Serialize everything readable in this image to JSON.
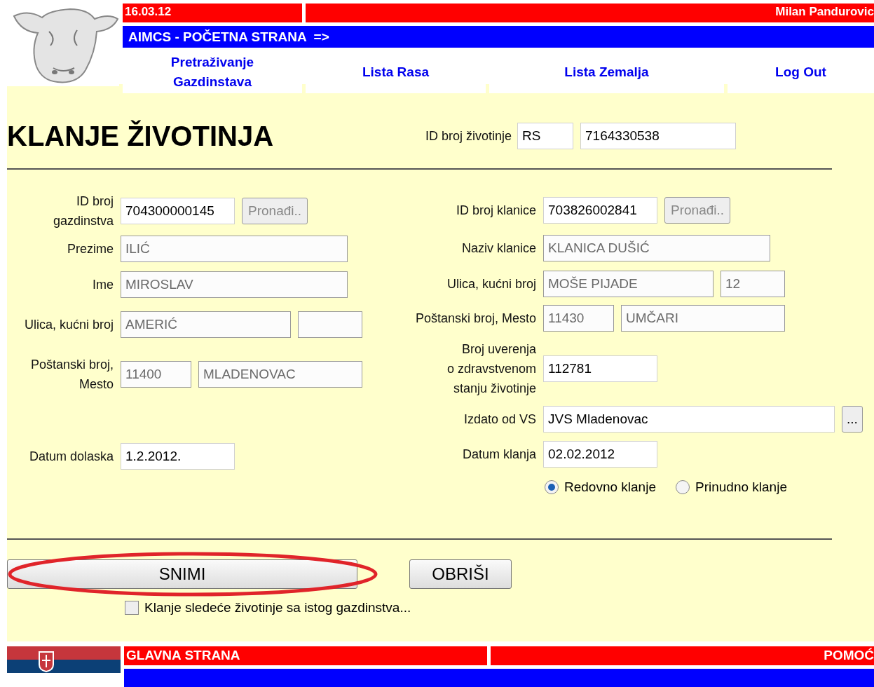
{
  "header": {
    "date": "16.03.12",
    "user": "Milan Pandurovic",
    "breadcrumb": "AIMCS - POČETNA STRANA  =>",
    "nav": [
      {
        "label": "Pretraživanje\nGazdinstava"
      },
      {
        "label": "Lista Rasa"
      },
      {
        "label": "Lista Zemalja"
      },
      {
        "label": "Log Out"
      }
    ]
  },
  "title": "KLANJE ŽIVOTINJA",
  "animal_id": {
    "label": "ID broj životinje",
    "country": "RS",
    "number": "7164330538"
  },
  "left_fields": [
    {
      "label": "ID broj\ngazdinstva",
      "inputs": [
        {
          "value": "704300000145",
          "disabled": false,
          "kind": "medium"
        }
      ],
      "button": "Pronađi.."
    },
    {
      "label": "Prezime",
      "inputs": [
        {
          "value": "ILIĆ",
          "disabled": true,
          "kind": "long"
        }
      ]
    },
    {
      "label": "Ime",
      "inputs": [
        {
          "value": "MIROSLAV",
          "disabled": true,
          "kind": "long"
        }
      ]
    },
    {
      "label": "Ulica, kućni broj",
      "inputs": [
        {
          "value": "AMERIĆ",
          "disabled": true,
          "kind": "street"
        },
        {
          "disabled": true,
          "kind": "short"
        }
      ]
    },
    {
      "label": "Poštanski broj,\nMesto",
      "inputs": [
        {
          "value": "11400",
          "disabled": true,
          "kind": "zip"
        },
        {
          "value": "MLADENOVAC",
          "disabled": true,
          "kind": "city"
        }
      ]
    },
    {
      "label": "Datum dolaska",
      "inputs": [
        {
          "value": "1.2.2012.",
          "disabled": false,
          "kind": "medium"
        }
      ]
    }
  ],
  "right_fields": [
    {
      "label": "ID broj klanice",
      "inputs": [
        {
          "value": "703826002841",
          "disabled": false,
          "kind": "medium"
        }
      ],
      "button": "Pronađi.."
    },
    {
      "label": "Naziv klanice",
      "inputs": [
        {
          "value": "KLANICA DUŠIĆ",
          "disabled": true,
          "kind": "long"
        }
      ]
    },
    {
      "label": "Ulica, kućni broj",
      "inputs": [
        {
          "value": "MOŠE PIJADE",
          "disabled": true,
          "kind": "street"
        },
        {
          "value": "12",
          "disabled": true,
          "kind": "short"
        }
      ]
    },
    {
      "label": "Poštanski broj, Mesto",
      "inputs": [
        {
          "value": "11430",
          "disabled": true,
          "kind": "zip"
        },
        {
          "value": "UMČARI",
          "disabled": true,
          "kind": "city"
        }
      ]
    },
    {
      "label": "Broj uverenja\no zdravstvenom\nstanju životinje",
      "inputs": [
        {
          "value": "112781",
          "disabled": false,
          "kind": "medium"
        }
      ]
    },
    {
      "label": "Izdato od VS",
      "inputs": [
        {
          "value": "JVS Mladenovac",
          "disabled": false,
          "kind": "xlong"
        }
      ],
      "button": "..."
    },
    {
      "label": "Datum klanja",
      "inputs": [
        {
          "value": "02.02.2012",
          "disabled": false,
          "kind": "medium"
        }
      ]
    }
  ],
  "radios": [
    {
      "label": "Redovno klanje",
      "selected": true
    },
    {
      "label": "Prinudno klanje",
      "selected": false
    }
  ],
  "actions": [
    {
      "label": "SNIMI",
      "kind": "wide"
    },
    {
      "label": "OBRIŠI",
      "kind": "normal"
    }
  ],
  "next_animal": {
    "label": "Klanje sledeće životinje sa istog gazdinstva...",
    "checked": false
  },
  "footer": {
    "home": "GLAVNA STRANA",
    "help": "POMOĆ"
  }
}
